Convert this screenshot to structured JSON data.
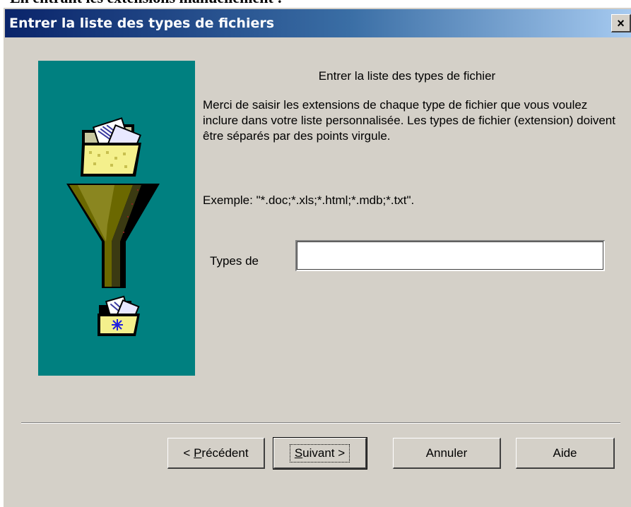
{
  "document": {
    "heading": "En entrant les extensions manuellement :"
  },
  "window": {
    "title": "Entrer la liste des types de fichiers",
    "close_label": "×"
  },
  "main": {
    "heading": "Entrer la liste des types de fichier",
    "description": "Merci de saisir les extensions de chaque type de fichier que vous voulez inclure dans votre liste personnalisée.  Les types de fichier (extension) doivent être séparés par des points virgule.",
    "example": "Exemple: \"*.doc;*.xls;*.html;*.mdb;*.txt\".",
    "field_label": "Types de",
    "field_value": ""
  },
  "buttons": {
    "previous": {
      "prefix": "< ",
      "mnemonic": "P",
      "rest": "récédent"
    },
    "next": {
      "mnemonic": "S",
      "rest": "uivant >"
    },
    "cancel": "Annuler",
    "help": "Aide"
  },
  "colors": {
    "dialog_bg": "#d4d0c8",
    "panel_bg": "#008080",
    "titlebar_start": "#0a246a",
    "titlebar_end": "#a6caf0"
  },
  "icons": [
    "folder-documents-icon",
    "funnel-icon",
    "new-folder-icon"
  ]
}
